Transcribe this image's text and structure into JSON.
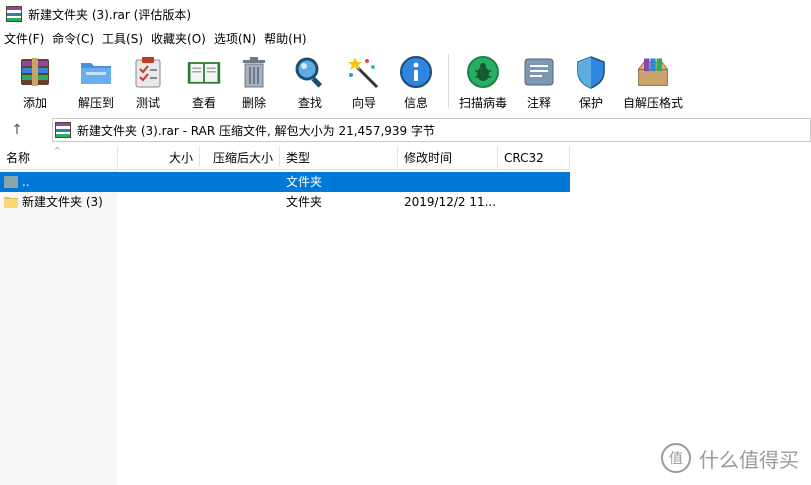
{
  "window": {
    "title": "新建文件夹 (3).rar (评估版本)"
  },
  "menu": [
    {
      "label": "文件(F)"
    },
    {
      "label": "命令(C)"
    },
    {
      "label": "工具(S)"
    },
    {
      "label": "收藏夹(O)"
    },
    {
      "label": "选项(N)"
    },
    {
      "label": "帮助(H)"
    }
  ],
  "toolbar": [
    {
      "label": "添加",
      "icon": "add-archive-icon"
    },
    {
      "label": "解压到",
      "icon": "extract-to-icon"
    },
    {
      "label": "测试",
      "icon": "test-icon"
    },
    {
      "label": "查看",
      "icon": "view-icon"
    },
    {
      "label": "删除",
      "icon": "delete-icon"
    },
    {
      "label": "查找",
      "icon": "find-icon"
    },
    {
      "label": "向导",
      "icon": "wizard-icon"
    },
    {
      "label": "信息",
      "icon": "info-icon"
    },
    {
      "label": "扫描病毒",
      "icon": "virus-scan-icon"
    },
    {
      "label": "注释",
      "icon": "comment-icon"
    },
    {
      "label": "保护",
      "icon": "protect-icon"
    },
    {
      "label": "自解压格式",
      "icon": "sfx-icon"
    }
  ],
  "address": {
    "up_icon": "↑",
    "text": "新建文件夹 (3).rar - RAR 压缩文件, 解包大小为 21,457,939 字节"
  },
  "columns": [
    {
      "label": "名称"
    },
    {
      "label": "大小"
    },
    {
      "label": "压缩后大小"
    },
    {
      "label": "类型"
    },
    {
      "label": "修改时间"
    },
    {
      "label": "CRC32"
    }
  ],
  "rows": [
    {
      "name": "..",
      "size": "",
      "packed": "",
      "type": "文件夹",
      "modified": "",
      "crc": "",
      "selected": true
    },
    {
      "name": "新建文件夹 (3)",
      "size": "",
      "packed": "",
      "type": "文件夹",
      "modified": "2019/12/2 11...",
      "crc": "",
      "selected": false
    }
  ],
  "watermark": {
    "badge": "值",
    "text": "什么值得买"
  },
  "colors": {
    "selection": "#0078d7",
    "folder": "#f8d775"
  }
}
